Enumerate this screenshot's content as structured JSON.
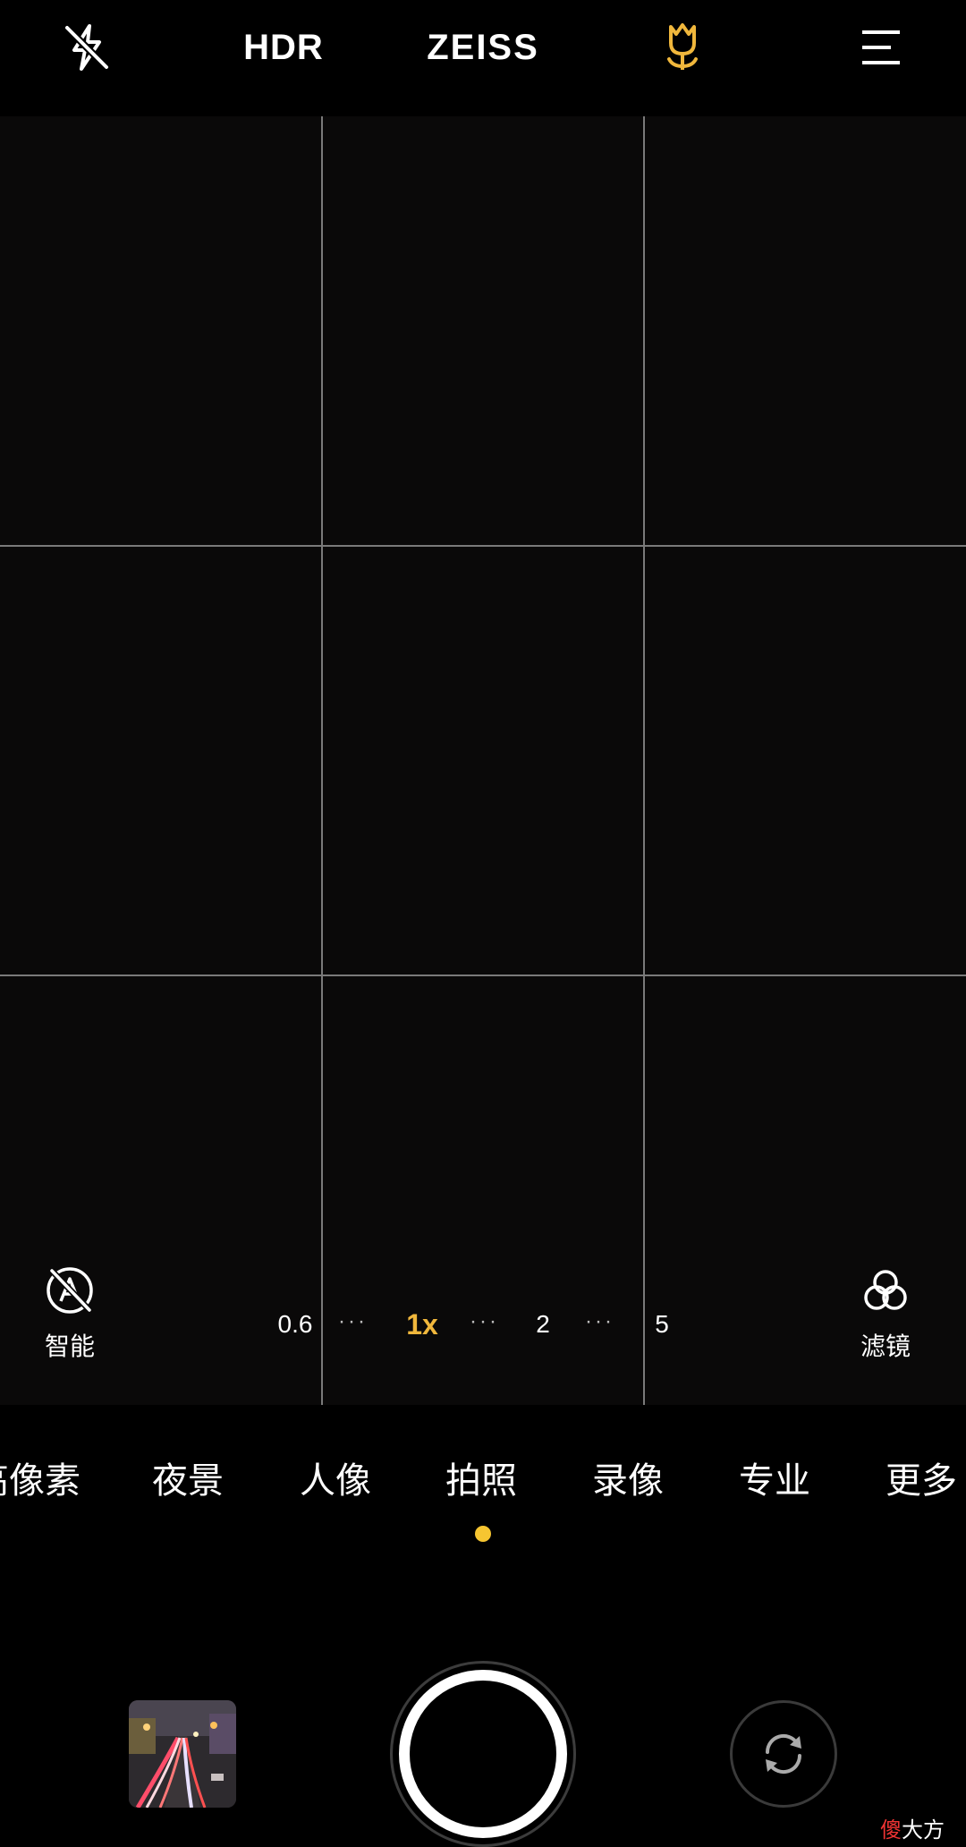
{
  "topbar": {
    "flash_icon": "flash-off-icon",
    "hdr_label": "HDR",
    "brand_label": "ZEISS",
    "macro_icon": "tulip-macro-icon",
    "menu_icon": "hamburger-menu-icon",
    "accent_color": "#f0b73c"
  },
  "controls": {
    "smart_label": "智能",
    "filter_label": "滤镜"
  },
  "zoom": {
    "levels": [
      "0.6",
      "1x",
      "2",
      "5"
    ],
    "selected": "1x",
    "separator": "···"
  },
  "modes": {
    "items": [
      "高像素",
      "夜景",
      "人像",
      "拍照",
      "录像",
      "专业",
      "更多"
    ],
    "selected": "拍照",
    "indicator_color": "#f6c531"
  },
  "bottom": {
    "gallery_thumbnail": "night-street-light-trails",
    "shutter_icon": "shutter-button",
    "switch_icon": "camera-switch-icon"
  },
  "watermark": {
    "first_char": "傻",
    "rest": "大方"
  }
}
